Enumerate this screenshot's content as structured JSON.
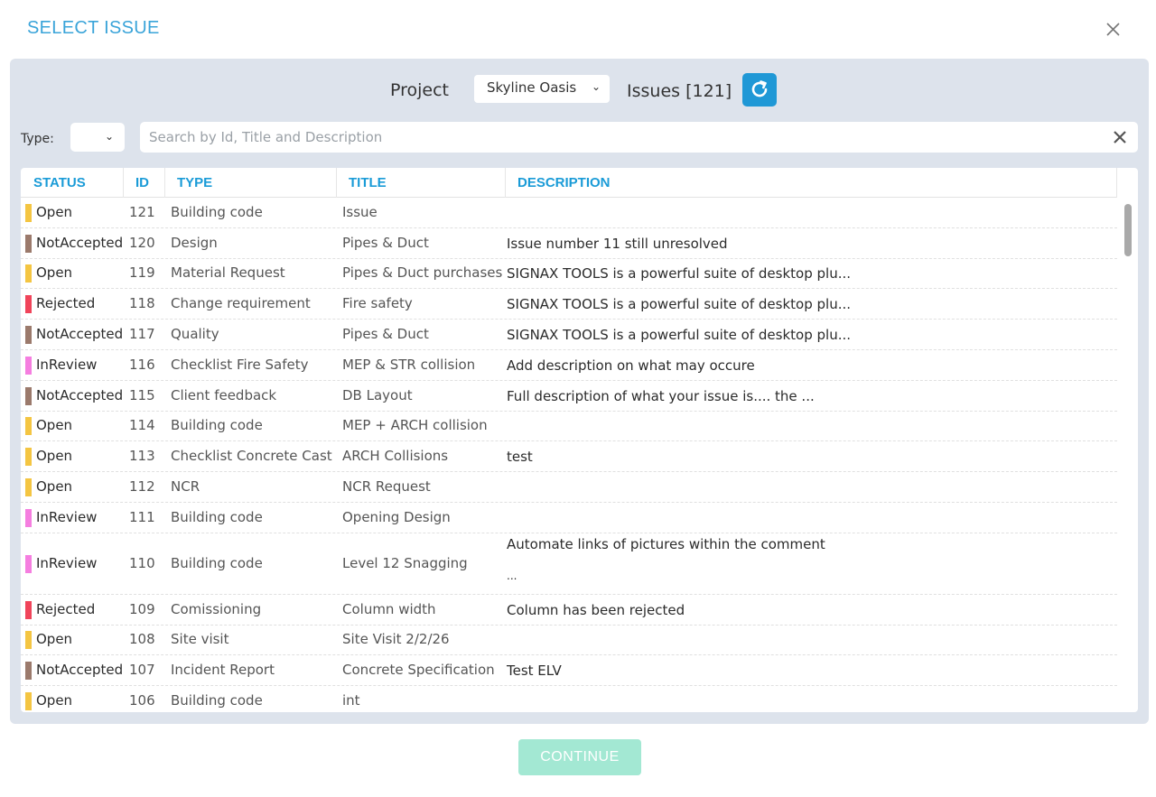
{
  "dialog": {
    "title": "SELECT ISSUE"
  },
  "project": {
    "label": "Project",
    "selected": "Skyline Oasis",
    "issues_label": "Issues [121]"
  },
  "filter": {
    "type_label": "Type:",
    "type_selected": "",
    "search_placeholder": "Search by Id, Title and Description",
    "search_value": ""
  },
  "table": {
    "headers": {
      "status": "STATUS",
      "id": "ID",
      "type": "TYPE",
      "title": "TITLE",
      "description": "DESCRIPTION"
    },
    "rows": [
      {
        "status": "Open",
        "color": "#f4c542",
        "id": "121",
        "type": "Building code",
        "title": "Issue",
        "description": ""
      },
      {
        "status": "NotAccepted",
        "color": "#9b7a6c",
        "id": "120",
        "type": "Design",
        "title": "Pipes & Duct",
        "description": "Issue number 11 still unresolved"
      },
      {
        "status": "Open",
        "color": "#f4c542",
        "id": "119",
        "type": "Material Request",
        "title": "Pipes & Duct purchases",
        "description": "SIGNAX TOOLS is a powerful suite of desktop plu..."
      },
      {
        "status": "Rejected",
        "color": "#f0445a",
        "id": "118",
        "type": "Change requirement",
        "title": "Fire safety",
        "description": "SIGNAX TOOLS is a powerful suite of desktop plu..."
      },
      {
        "status": "NotAccepted",
        "color": "#9b7a6c",
        "id": "117",
        "type": "Quality",
        "title": "Pipes & Duct",
        "description": "SIGNAX TOOLS is a powerful suite of desktop plu..."
      },
      {
        "status": "InReview",
        "color": "#f57ee0",
        "id": "116",
        "type": "Checklist Fire Safety",
        "title": "MEP & STR collision",
        "description": "Add description on what may occure"
      },
      {
        "status": "NotAccepted",
        "color": "#9b7a6c",
        "id": "115",
        "type": "Client feedback",
        "title": "DB Layout",
        "description": "Full description of what your issue is.... the ..."
      },
      {
        "status": "Open",
        "color": "#f4c542",
        "id": "114",
        "type": "Building code",
        "title": "MEP + ARCH collision",
        "description": ""
      },
      {
        "status": "Open",
        "color": "#f4c542",
        "id": "113",
        "type": "Checklist Concrete Cast",
        "title": "ARCH Collisions",
        "description": "test"
      },
      {
        "status": "Open",
        "color": "#f4c542",
        "id": "112",
        "type": "NCR",
        "title": "NCR Request",
        "description": ""
      },
      {
        "status": "InReview",
        "color": "#f57ee0",
        "id": "111",
        "type": "Building code",
        "title": "Opening Design",
        "description": ""
      },
      {
        "status": "InReview",
        "color": "#f57ee0",
        "id": "110",
        "type": "Building code",
        "title": "Level 12 Snagging",
        "description": "Automate links of pictures within the comment",
        "description_extra": "...",
        "tall": true
      },
      {
        "status": "Rejected",
        "color": "#f0445a",
        "id": "109",
        "type": "Comissioning",
        "title": "Column width",
        "description": "Column has been rejected"
      },
      {
        "status": "Open",
        "color": "#f4c542",
        "id": "108",
        "type": "Site visit",
        "title": "Site Visit 2/2/26",
        "description": ""
      },
      {
        "status": "NotAccepted",
        "color": "#9b7a6c",
        "id": "107",
        "type": "Incident Report",
        "title": "Concrete Specification",
        "description": "Test ELV"
      },
      {
        "status": "Open",
        "color": "#f4c542",
        "id": "106",
        "type": "Building code",
        "title": "int",
        "description": ""
      }
    ]
  },
  "footer": {
    "continue_label": "CONTINUE"
  }
}
